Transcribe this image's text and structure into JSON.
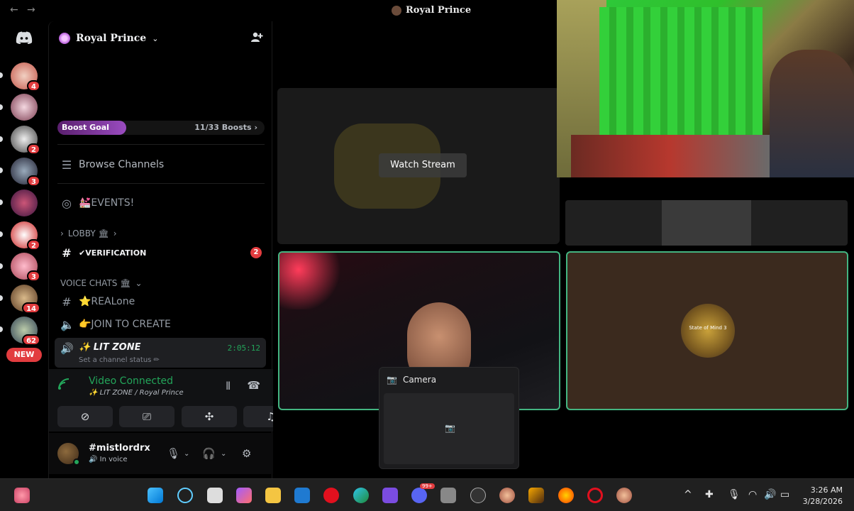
{
  "window": {
    "title": "Royal Prince",
    "back": "←",
    "forward": "→"
  },
  "rail": {
    "badges": [
      "4",
      "2",
      "3",
      "2",
      "3",
      "14",
      "62"
    ],
    "new_label": "NEW"
  },
  "server": {
    "name": "Royal Prince",
    "boost_goal": "Boost Goal",
    "boost_count": "11/33 Boosts",
    "boost_chevron": "›",
    "boost_progress": 0.333
  },
  "channels": {
    "browse": "Browse Channels",
    "events": "💒EVENTS!",
    "lobby_category": "LOBBY 🏛",
    "verification": "✔VERIFICATION",
    "verification_mentions": "2",
    "voice_category": "VOICE CHATS 🏛",
    "realone": "⭐REALone",
    "join_to_create": "👉JOIN TO CREATE",
    "lit_zone": "✨ LIT ZONE",
    "lit_timer": "2:05:12",
    "lit_status": "Set a channel status ✏"
  },
  "voice": {
    "title": "Video Connected",
    "sub": "✨ LIT ZONE / Royal Prince"
  },
  "user": {
    "name": "#mistlordrx",
    "status": "🔊 In voice"
  },
  "stage": {
    "watch_stream": "Watch Stream",
    "camera_label": "Camera",
    "logo_text": "State of Mind 3"
  },
  "taskbar": {
    "time": "3:26 AM",
    "date": "3/28/2026",
    "discord_badge": "99+"
  }
}
